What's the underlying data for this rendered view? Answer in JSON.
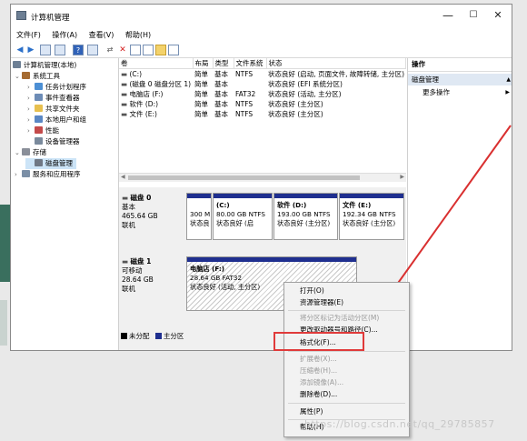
{
  "window": {
    "title": "计算机管理",
    "controls": [
      "—",
      "☐",
      "✕"
    ]
  },
  "menubar": [
    "文件(F)",
    "操作(A)",
    "查看(V)",
    "帮助(H)"
  ],
  "tree": {
    "root": "计算机管理(本地)",
    "system_tools": "系统工具",
    "items": [
      "任务计划程序",
      "事件查看器",
      "共享文件夹",
      "本地用户和组",
      "性能",
      "设备管理器"
    ],
    "storage": "存储",
    "disk_management": "磁盘管理",
    "services": "服务和应用程序"
  },
  "volume_table": {
    "headers": [
      "卷",
      "布局",
      "类型",
      "文件系统",
      "状态"
    ],
    "rows": [
      [
        "(C:)",
        "简单",
        "基本",
        "NTFS",
        "状态良好 (启动, 页面文件, 故障转储, 主分区)"
      ],
      [
        "(磁盘 0 磁盘分区 1)",
        "简单",
        "基本",
        "",
        "状态良好 (EFI 系统分区)"
      ],
      [
        "电脑店 (F:)",
        "简单",
        "基本",
        "FAT32",
        "状态良好 (活动, 主分区)"
      ],
      [
        "软件 (D:)",
        "简单",
        "基本",
        "NTFS",
        "状态良好 (主分区)"
      ],
      [
        "文件 (E:)",
        "简单",
        "基本",
        "NTFS",
        "状态良好 (主分区)"
      ]
    ]
  },
  "disk0": {
    "name": "磁盘 0",
    "type": "基本",
    "size": "465.64 GB",
    "status": "联机",
    "partitions": [
      {
        "title": "",
        "line1": "300 M",
        "line2": "状态良"
      },
      {
        "title": "(C:)",
        "line1": "80.00 GB NTFS",
        "line2": "状态良好 (启"
      },
      {
        "title": "软件 (D:)",
        "line1": "193.00 GB NTFS",
        "line2": "状态良好 (主分区)"
      },
      {
        "title": "文件 (E:)",
        "line1": "192.34 GB NTFS",
        "line2": "状态良好 (主分区)"
      }
    ]
  },
  "disk1": {
    "name": "磁盘 1",
    "type": "可移动",
    "size": "28.64 GB",
    "status": "联机",
    "partition": {
      "title": "电脑店 (F:)",
      "line1": "28.64 GB FAT32",
      "line2": "状态良好 (活动, 主分区)"
    }
  },
  "legend": {
    "unallocated": "未分配",
    "primary": "主分区"
  },
  "actions": {
    "header": "操作",
    "section": "磁盘管理",
    "more": "更多操作"
  },
  "context_menu": {
    "items": [
      {
        "label": "打开(O)",
        "disabled": false
      },
      {
        "label": "资源管理器(E)",
        "disabled": false
      },
      {
        "label": "将分区标记为活动分区(M)",
        "disabled": true
      },
      {
        "label": "更改驱动器号和路径(C)...",
        "disabled": false
      },
      {
        "label": "格式化(F)...",
        "disabled": false
      },
      {
        "label": "扩展卷(X)...",
        "disabled": true
      },
      {
        "label": "压缩卷(H)...",
        "disabled": true
      },
      {
        "label": "添加镜像(A)...",
        "disabled": true
      },
      {
        "label": "删除卷(D)...",
        "disabled": false
      },
      {
        "label": "属性(P)",
        "disabled": false
      },
      {
        "label": "帮助(H)",
        "disabled": false
      }
    ]
  },
  "watermark": "https://blog.csdn.net/qq_29785857",
  "colors": {
    "primary_partition": "#1f2f8f",
    "highlight": "#e03a3a",
    "arrow": "#d93030"
  }
}
